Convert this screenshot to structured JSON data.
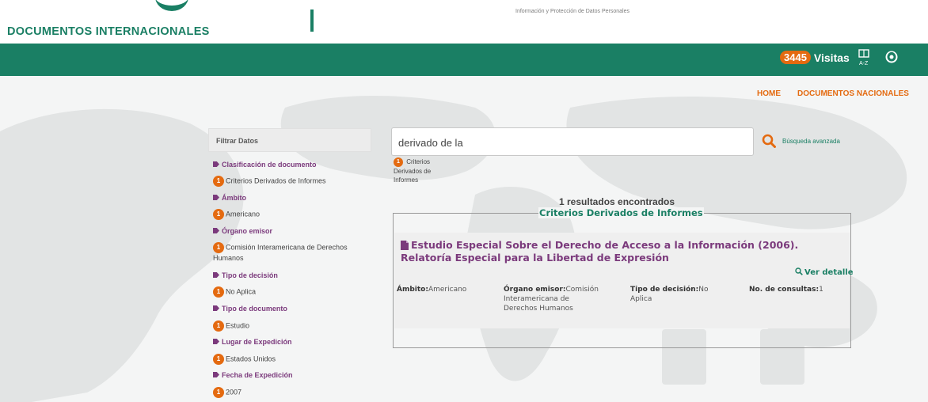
{
  "header": {
    "logo_text": "DOCUMENTOS INTERNACIONALES",
    "institute_text": "Información y Protección de Datos Personales"
  },
  "topbar": {
    "visit_count": "3445",
    "visit_label": "Visitas",
    "az_icon": "az-index-icon",
    "refresh_icon": "refresh-icon",
    "brand_color": "#1a7f64",
    "accent_color": "#e46a10"
  },
  "nav": {
    "home": "HOME",
    "nacionales": "DOCUMENTOS NACIONALES"
  },
  "sidebar": {
    "title": "Filtrar Datos",
    "facets": [
      {
        "title": "Clasificación de documento",
        "count": "1",
        "value": "Criterios Derivados de Informes"
      },
      {
        "title": "Ámbito",
        "count": "1",
        "value": "Americano"
      },
      {
        "title": "Órgano emisor",
        "count": "1",
        "value": "Comisión Interamericana de Derechos Humanos"
      },
      {
        "title": "Tipo de decisión",
        "count": "1",
        "value": "No Aplica"
      },
      {
        "title": "Tipo de documento",
        "count": "1",
        "value": "Estudio"
      },
      {
        "title": "Lugar de Expedición",
        "count": "1",
        "value": "Estados Unidos"
      },
      {
        "title": "Fecha de Expedición",
        "count": "1",
        "value": "2007"
      }
    ]
  },
  "search": {
    "value": "derivado de la",
    "advanced_link": "Búsqueda avanzada",
    "suggestion_count": "1",
    "suggestion_text": "Criterios Derivados de Informes"
  },
  "results": {
    "count_text": "1 resultados encontrados",
    "group_title": "Criterios Derivados de Informes",
    "items": [
      {
        "title": "Estudio Especial Sobre el Derecho de Acceso a la Información (2006). Relatoría Especial para la Libertad de Expresión",
        "detail_link": "Ver detalle",
        "ambito_label": "Ámbito:",
        "ambito_value": "Americano",
        "organo_label": "Órgano emisor:",
        "organo_value": "Comisión Interamericana de Derechos Humanos",
        "tipo_label": "Tipo de decisión:",
        "tipo_value": "No Aplica",
        "consultas_label": "No. de consultas:",
        "consultas_value": "1"
      }
    ]
  }
}
